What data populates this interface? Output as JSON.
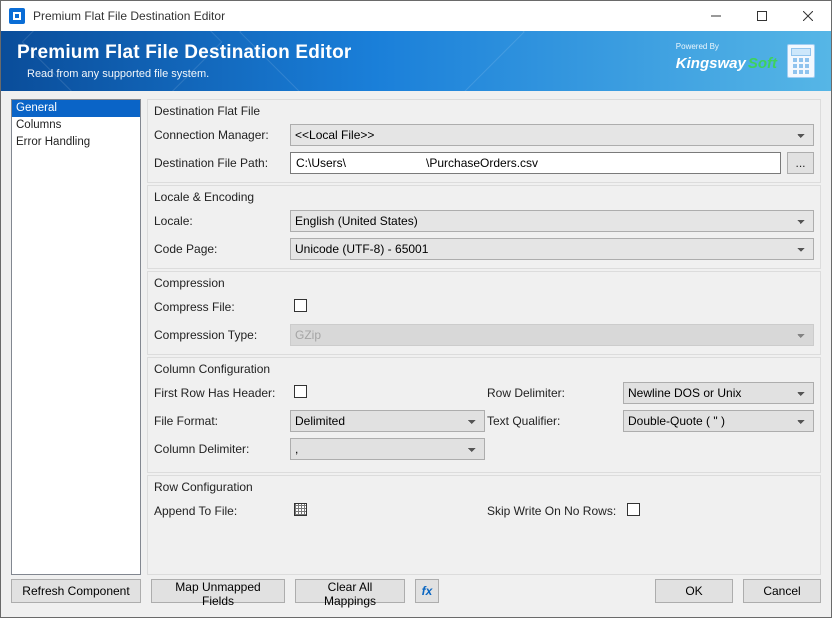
{
  "title": "Premium Flat File Destination Editor",
  "banner": {
    "title": "Premium Flat File Destination Editor",
    "subtitle": "Read from any supported file system.",
    "powered_by": "Powered By",
    "brand1": "Kingsway",
    "brand2": "Soft"
  },
  "sidebar": {
    "items": [
      {
        "label": "General",
        "selected": true
      },
      {
        "label": "Columns",
        "selected": false
      },
      {
        "label": "Error Handling",
        "selected": false
      }
    ]
  },
  "groups": {
    "dest": {
      "title": "Destination Flat File",
      "conn_mgr_label": "Connection Manager:",
      "conn_mgr_value": "<<Local File>>",
      "path_label": "Destination File Path:",
      "path_value": "C:\\Users\\                        \\PurchaseOrders.csv",
      "browse_label": "..."
    },
    "locale": {
      "title": "Locale & Encoding",
      "locale_label": "Locale:",
      "locale_value": "English (United States)",
      "codepage_label": "Code Page:",
      "codepage_value": "Unicode (UTF-8) - 65001"
    },
    "compression": {
      "title": "Compression",
      "compress_label": "Compress File:",
      "type_label": "Compression Type:",
      "type_value": "GZip"
    },
    "colconf": {
      "title": "Column Configuration",
      "first_row_label": "First Row Has Header:",
      "file_format_label": "File Format:",
      "file_format_value": "Delimited",
      "col_delim_label": "Column Delimiter:",
      "col_delim_value": ",",
      "row_delim_label": "Row Delimiter:",
      "row_delim_value": "Newline DOS or Unix",
      "text_qual_label": "Text Qualifier:",
      "text_qual_value": "Double-Quote ( \" )"
    },
    "rowconf": {
      "title": "Row Configuration",
      "append_label": "Append To File:",
      "skip_label": "Skip Write On No Rows:"
    }
  },
  "footer": {
    "refresh": "Refresh Component",
    "map": "Map Unmapped Fields",
    "clear": "Clear All Mappings",
    "fx": "fx",
    "ok": "OK",
    "cancel": "Cancel"
  }
}
